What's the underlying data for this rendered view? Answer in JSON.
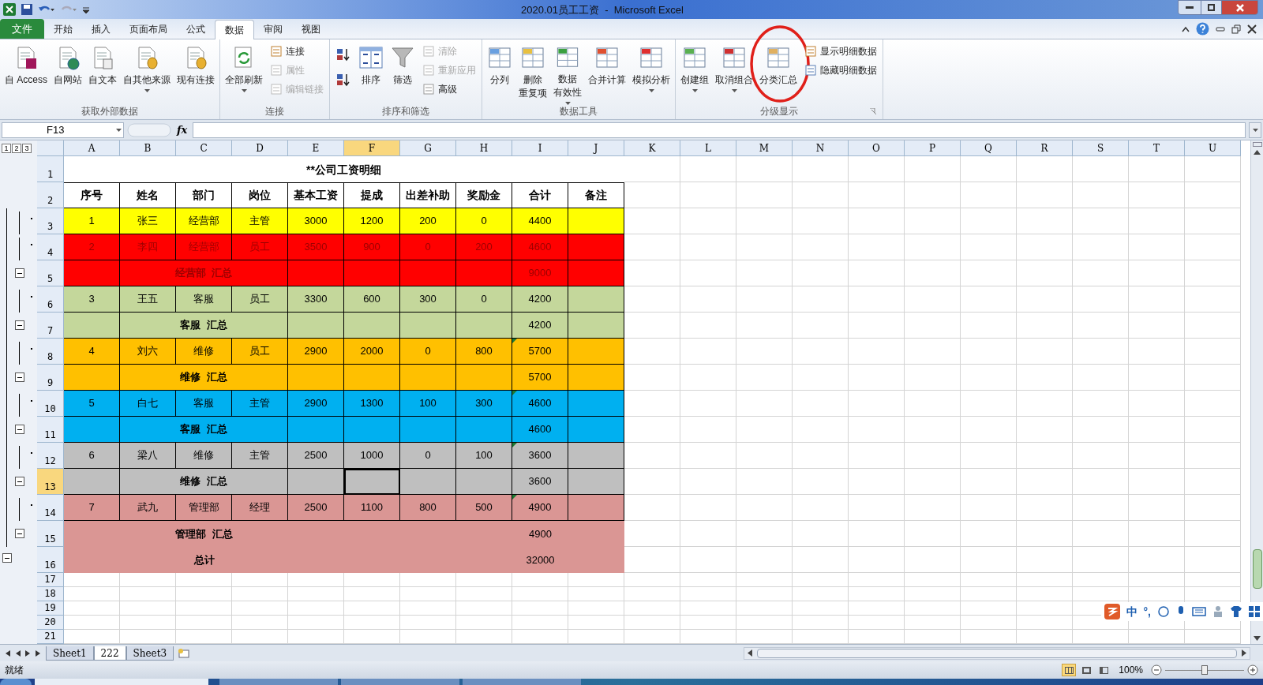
{
  "window": {
    "title": "2020.01员工工资  -  Microsoft Excel"
  },
  "tabs": [
    {
      "label": "文件",
      "kind": "file",
      "selected": false
    },
    {
      "label": "开始",
      "kind": "tab",
      "selected": false
    },
    {
      "label": "插入",
      "kind": "tab",
      "selected": false
    },
    {
      "label": "页面布局",
      "kind": "tab",
      "selected": false
    },
    {
      "label": "公式",
      "kind": "tab",
      "selected": false
    },
    {
      "label": "数据",
      "kind": "tab",
      "selected": true
    },
    {
      "label": "审阅",
      "kind": "tab",
      "selected": false
    },
    {
      "label": "视图",
      "kind": "tab",
      "selected": false
    }
  ],
  "ribbon": {
    "groups": [
      {
        "label": "获取外部数据",
        "columns": [
          [
            {
              "label": "自 Access",
              "kind": "large",
              "dropdown": false
            }
          ],
          [
            {
              "label": "自网站",
              "kind": "large",
              "dropdown": false
            }
          ],
          [
            {
              "label": "自文本",
              "kind": "large",
              "dropdown": false
            }
          ],
          [
            {
              "label": "自其他来源",
              "kind": "large",
              "dropdown": true
            }
          ],
          [
            {
              "label": "现有连接",
              "kind": "large",
              "dropdown": false
            }
          ]
        ]
      },
      {
        "label": "连接",
        "columns": [
          [
            {
              "label": "全部刷新",
              "kind": "large",
              "dropdown": true
            }
          ],
          [
            {
              "label": "连接",
              "kind": "small",
              "disabled": false
            },
            {
              "label": "属性",
              "kind": "small",
              "disabled": true
            },
            {
              "label": "编辑链接",
              "kind": "small",
              "disabled": true
            }
          ]
        ]
      },
      {
        "label": "排序和筛选",
        "columns": [
          [
            {
              "kind": "icon"
            },
            {
              "kind": "icon"
            }
          ],
          [
            {
              "label": "排序",
              "kind": "large",
              "dropdown": false
            }
          ],
          [
            {
              "label": "筛选",
              "kind": "large",
              "dropdown": false
            }
          ],
          [
            {
              "label": "清除",
              "kind": "small",
              "disabled": true
            },
            {
              "label": "重新应用",
              "kind": "small",
              "disabled": true
            },
            {
              "label": "高级",
              "kind": "small",
              "disabled": false
            }
          ]
        ]
      },
      {
        "label": "数据工具",
        "columns": [
          [
            {
              "label": "分列",
              "kind": "large",
              "dropdown": false
            }
          ],
          [
            {
              "lines": [
                "删除",
                "重复项"
              ],
              "kind": "large",
              "dropdown": false
            }
          ],
          [
            {
              "lines": [
                "数据",
                "有效性"
              ],
              "kind": "large",
              "dropdown": true
            }
          ],
          [
            {
              "label": "合并计算",
              "kind": "large",
              "dropdown": false
            }
          ],
          [
            {
              "label": "模拟分析",
              "kind": "large",
              "dropdown": true
            }
          ]
        ]
      },
      {
        "label": "分级显示",
        "launcher": true,
        "columns": [
          [
            {
              "label": "创建组",
              "kind": "large",
              "dropdown": true
            }
          ],
          [
            {
              "label": "取消组合",
              "kind": "large",
              "dropdown": true
            }
          ],
          [
            {
              "label": "分类汇总",
              "kind": "large",
              "dropdown": false,
              "highlighted": true
            }
          ],
          [
            {
              "label": "显示明细数据",
              "kind": "small",
              "disabled": false
            },
            {
              "label": "隐藏明细数据",
              "kind": "small",
              "disabled": false
            }
          ]
        ]
      }
    ]
  },
  "formula_bar": {
    "name_box": "F13",
    "function_label": "fx"
  },
  "outline_levels": [
    "1",
    "2",
    "3"
  ],
  "sheet": {
    "columns": [
      {
        "label": "A",
        "selected": false
      },
      {
        "label": "B",
        "selected": false
      },
      {
        "label": "C",
        "selected": false
      },
      {
        "label": "D",
        "selected": false
      },
      {
        "label": "E",
        "selected": false
      },
      {
        "label": "F",
        "selected": true
      },
      {
        "label": "G",
        "selected": false
      },
      {
        "label": "H",
        "selected": false
      },
      {
        "label": "I",
        "selected": false
      },
      {
        "label": "J",
        "selected": false
      },
      {
        "label": "K",
        "selected": false
      },
      {
        "label": "L",
        "selected": false
      },
      {
        "label": "M",
        "selected": false
      },
      {
        "label": "N",
        "selected": false
      },
      {
        "label": "O",
        "selected": false
      },
      {
        "label": "P",
        "selected": false
      },
      {
        "label": "Q",
        "selected": false
      },
      {
        "label": "R",
        "selected": false
      },
      {
        "label": "S",
        "selected": false
      },
      {
        "label": "T",
        "selected": false
      },
      {
        "label": "U",
        "selected": false
      }
    ],
    "rows": [
      {
        "number": "1",
        "selected": false,
        "kind": "title",
        "title": "**公司工资明细"
      },
      {
        "number": "2",
        "selected": false,
        "kind": "header",
        "cells": [
          "序号",
          "姓名",
          "部门",
          "岗位",
          "基本工资",
          "提成",
          "出差补助",
          "奖励金",
          "合计",
          "备注"
        ]
      },
      {
        "number": "3",
        "selected": false,
        "kind": "data",
        "outline": {
          "kind": "detail"
        },
        "color": "#ffff00",
        "dim_text": false,
        "error_mark": false,
        "cells": [
          "1",
          "张三",
          "经营部",
          "主管",
          "3000",
          "1200",
          "200",
          "0",
          "4400"
        ]
      },
      {
        "number": "4",
        "selected": false,
        "kind": "data",
        "outline": {
          "kind": "detail"
        },
        "color": "#ff0000",
        "dim_text": true,
        "error_mark": false,
        "cells": [
          "2",
          "李四",
          "经营部",
          "员工",
          "3500",
          "900",
          "0",
          "200",
          "4600"
        ]
      },
      {
        "number": "5",
        "selected": false,
        "kind": "subtotal",
        "outline": {
          "kind": "collapse"
        },
        "color": "#ff0000",
        "dim_text": true,
        "label": "经营部  汇总",
        "total": "9000"
      },
      {
        "number": "6",
        "selected": false,
        "kind": "data",
        "outline": {
          "kind": "detail"
        },
        "color": "#c4d79b",
        "error_mark": false,
        "cells": [
          "3",
          "王五",
          "客服",
          "员工",
          "3300",
          "600",
          "300",
          "0",
          "4200"
        ]
      },
      {
        "number": "7",
        "selected": false,
        "kind": "subtotal",
        "outline": {
          "kind": "collapse"
        },
        "color": "#c4d79b",
        "label": "客服  汇总",
        "total": "4200"
      },
      {
        "number": "8",
        "selected": false,
        "kind": "data",
        "outline": {
          "kind": "detail"
        },
        "color": "#ffc000",
        "error_mark": true,
        "cells": [
          "4",
          "刘六",
          "维修",
          "员工",
          "2900",
          "2000",
          "0",
          "800",
          "5700"
        ]
      },
      {
        "number": "9",
        "selected": false,
        "kind": "subtotal",
        "outline": {
          "kind": "collapse"
        },
        "color": "#ffc000",
        "label": "维修  汇总",
        "total": "5700"
      },
      {
        "number": "10",
        "selected": false,
        "kind": "data",
        "outline": {
          "kind": "detail"
        },
        "color": "#00b0f0",
        "error_mark": true,
        "cells": [
          "5",
          "白七",
          "客服",
          "主管",
          "2900",
          "1300",
          "100",
          "300",
          "4600"
        ]
      },
      {
        "number": "11",
        "selected": false,
        "kind": "subtotal",
        "outline": {
          "kind": "collapse"
        },
        "color": "#00b0f0",
        "label": "客服  汇总",
        "total": "4600"
      },
      {
        "number": "12",
        "selected": false,
        "kind": "data",
        "outline": {
          "kind": "detail"
        },
        "color": "#bfbfbf",
        "error_mark": true,
        "cells": [
          "6",
          "梁八",
          "维修",
          "主管",
          "2500",
          "1000",
          "0",
          "100",
          "3600"
        ]
      },
      {
        "number": "13",
        "selected": true,
        "kind": "subtotal",
        "outline": {
          "kind": "collapse"
        },
        "color": "#bfbfbf",
        "label": "维修  汇总",
        "total": "3600"
      },
      {
        "number": "14",
        "selected": false,
        "kind": "data",
        "outline": {
          "kind": "detail"
        },
        "color": "#da9694",
        "error_mark": true,
        "cells": [
          "7",
          "武九",
          "管理部",
          "经理",
          "2500",
          "1100",
          "800",
          "500",
          "4900"
        ]
      },
      {
        "number": "15",
        "selected": false,
        "kind": "grand",
        "outline": {
          "kind": "collapse"
        },
        "color": "#da9694",
        "label": "管理部  汇总",
        "total": "4900"
      },
      {
        "number": "16",
        "selected": false,
        "kind": "grand",
        "outline": {
          "kind": "top"
        },
        "color": "#da9694",
        "label": "总计",
        "total": "32000"
      },
      {
        "number": "17",
        "selected": false,
        "kind": "blank"
      },
      {
        "number": "18",
        "selected": false,
        "kind": "blank"
      },
      {
        "number": "19",
        "selected": false,
        "kind": "blank"
      },
      {
        "number": "20",
        "selected": false,
        "kind": "blank"
      },
      {
        "number": "21",
        "selected": false,
        "kind": "blank"
      }
    ]
  },
  "sheet_tabs": [
    {
      "label": "Sheet1",
      "selected": false
    },
    {
      "label": "222",
      "selected": true
    },
    {
      "label": "Sheet3",
      "selected": false
    }
  ],
  "status_bar": {
    "status": "就绪",
    "zoom": "100%",
    "zoom_slider": {
      "level": 0.5
    },
    "views": [
      {
        "kind": "normal",
        "selected": true
      },
      {
        "kind": "layout",
        "selected": false
      },
      {
        "kind": "break",
        "selected": false
      }
    ]
  },
  "ime_bar": {
    "labels": [
      "中",
      "°,"
    ]
  }
}
